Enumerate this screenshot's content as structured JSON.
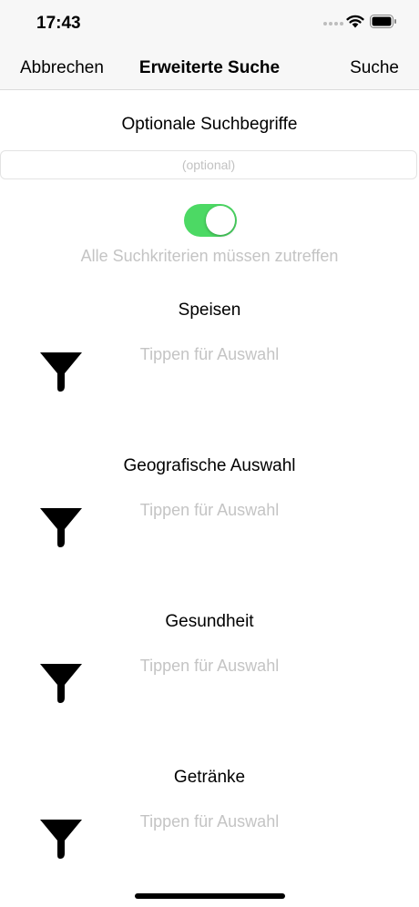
{
  "status_bar": {
    "time": "17:43",
    "icons": [
      "signal-dots-icon",
      "wifi-icon",
      "battery-icon"
    ]
  },
  "nav": {
    "cancel_label": "Abbrechen",
    "title": "Erweiterte Suche",
    "search_label": "Suche"
  },
  "search": {
    "heading": "Optionale Suchbegriffe",
    "placeholder": "(optional)",
    "value": ""
  },
  "match_all": {
    "enabled": true,
    "label": "Alle Suchkriterien müssen zutreffen"
  },
  "sections": [
    {
      "title": "Speisen",
      "prompt": "Tippen für Auswahl",
      "icon": "filter-icon"
    },
    {
      "title": "Geografische Auswahl",
      "prompt": "Tippen für Auswahl",
      "icon": "filter-icon"
    },
    {
      "title": "Gesundheit",
      "prompt": "Tippen für Auswahl",
      "icon": "filter-icon"
    },
    {
      "title": "Getränke",
      "prompt": "Tippen für Auswahl",
      "icon": "filter-icon"
    }
  ],
  "colors": {
    "toggle_on": "#4cd964",
    "placeholder_gray": "#c4c4c4",
    "bar_background": "#f7f7f7"
  }
}
